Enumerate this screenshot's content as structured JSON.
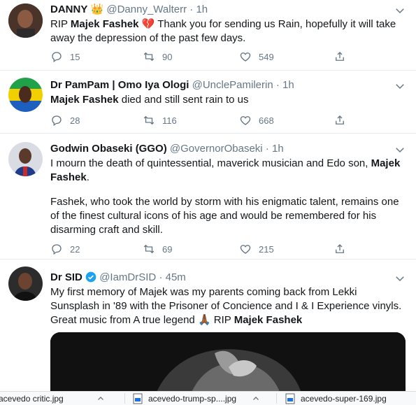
{
  "tweets": [
    {
      "name": "DANNY",
      "name_emoji": "👑",
      "handle": "@Danny_Walterr",
      "time": "1h",
      "text_before": "RIP ",
      "bold": "Majek Fashek",
      "text_after": " 💔 Thank you for sending us Rain, hopefully it will take away the depression of the past few days.",
      "replies": "15",
      "retweets": "90",
      "likes": "549"
    },
    {
      "name": "Dr PamPam | Omo Iya Ologi",
      "handle": "@UnclePamilerin",
      "time": "1h",
      "bold": "Majek Fashek",
      "text_after": " died and still sent rain to us",
      "replies": "28",
      "retweets": "116",
      "likes": "668"
    },
    {
      "name": "Godwin Obaseki (GGO)",
      "handle": "@GovernorObaseki",
      "time": "1h",
      "text_before": "I mourn the death of quintessential, maverick musician and Edo son, ",
      "bold": "Majek Fashek",
      "text_after": ".",
      "paragraph2": "Fashek, who took the world by storm with his enigmatic talent, remains one of the finest cultural icons of his age and would be remembered for his disarming craft and skill.",
      "replies": "22",
      "retweets": "69",
      "likes": "215"
    },
    {
      "name": "Dr SID",
      "handle": "@IamDrSID",
      "time": "45m",
      "text_before": "My first memory of Majek was my parents coming back from Lekki Sunsplash in '89 with the Prisoner of Concience and I & I Experience vinyls. Great music from A true legend ",
      "emoji": "🙏🏾",
      "text_mid": " RIP ",
      "bold": "Majek Fashek"
    }
  ],
  "downloads": [
    {
      "name": "acevedo critic.jpg"
    },
    {
      "name": "acevedo-trump-sp....jpg"
    },
    {
      "name": "acevedo-super-169.jpg"
    }
  ],
  "colors": {
    "text": "#14171a",
    "muted": "#657786",
    "blue": "#1da1f2",
    "border": "#e6ecf0"
  }
}
